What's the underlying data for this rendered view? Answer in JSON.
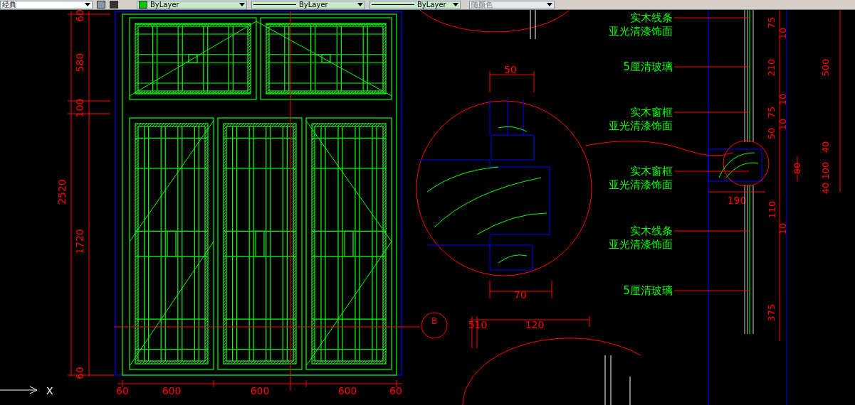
{
  "toolbar": {
    "workspace": "经典",
    "layer_color": "ByLayer",
    "linetype": "ByLayer",
    "lineweight": "ByLayer",
    "plot_style": "随颜色"
  },
  "drawing": {
    "elevation_dimensions": [
      "60",
      "580",
      "100",
      "2520",
      "1720",
      "60",
      "60",
      "600",
      "600",
      "600",
      "60"
    ],
    "detail_dimensions": [
      "50",
      "70",
      "510",
      "120",
      "190"
    ],
    "section_dimensions": [
      "75",
      "10",
      "210",
      "10",
      "75",
      "10",
      "50",
      "500",
      "40",
      "100",
      "40",
      "80",
      "110",
      "10",
      "375"
    ],
    "labels": [
      {
        "lines": [
          "实木线条",
          "亚光清漆饰面"
        ]
      },
      {
        "lines": [
          "5厘清玻璃"
        ]
      },
      {
        "lines": [
          "实木窗框",
          "亚光清漆饰面"
        ]
      },
      {
        "lines": [
          "实木窗框",
          "亚光清漆饰面"
        ]
      },
      {
        "lines": [
          "实木线条",
          "亚光清漆饰面"
        ]
      },
      {
        "lines": [
          "5厘清玻璃"
        ]
      }
    ],
    "section_marker": "B",
    "axis_label": "X"
  }
}
